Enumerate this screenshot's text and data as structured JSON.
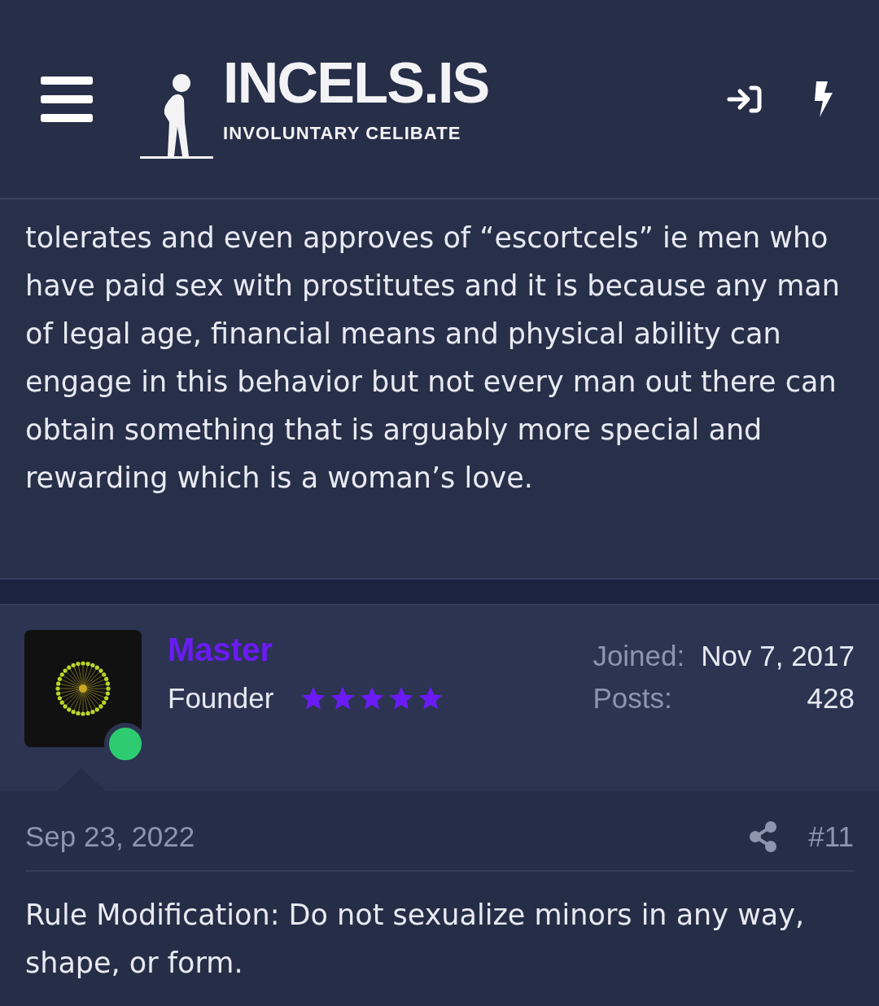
{
  "header": {
    "logo_title": "INCELS.IS",
    "logo_subtitle": "INVOLUNTARY CELIBATE"
  },
  "previous_post": {
    "text": "tolerates and even approves of “escortcels” ie men who have paid sex with prostitutes and it is because any man of legal age, financial means and physical ability can engage in this behavior but not every man out there can obtain something that is arguably more special and rewarding which is a woman’s love."
  },
  "user": {
    "name": "Master",
    "title": "Founder",
    "stars": 5,
    "online": true,
    "stats": [
      {
        "label": "Joined:",
        "value": "Nov 7, 2017"
      },
      {
        "label": "Posts:",
        "value": "428"
      }
    ]
  },
  "post": {
    "date": "Sep 23, 2022",
    "number": "#11",
    "text": "Rule Modification: Do not sexualize minors in any way, shape, or form."
  }
}
